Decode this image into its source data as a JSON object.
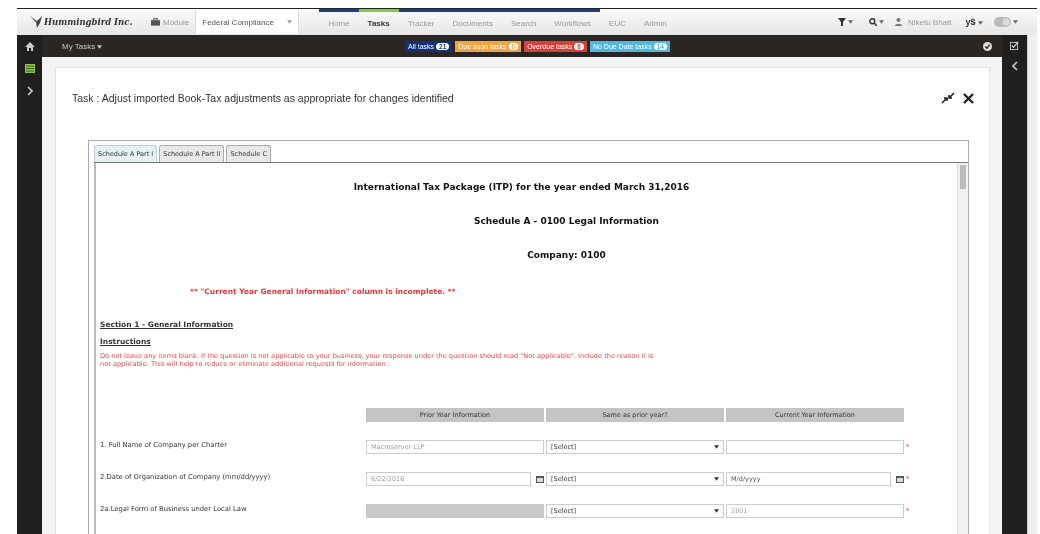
{
  "header": {
    "logo": "Hummingbird Inc.",
    "module_label": "Module",
    "module_select": "Federal Compliance",
    "nav": [
      {
        "label": "Home",
        "selected": false
      },
      {
        "label": "Tasks",
        "selected": true
      },
      {
        "label": "Tracker",
        "selected": false
      },
      {
        "label": "Documents",
        "selected": false
      },
      {
        "label": "Search",
        "selected": false
      },
      {
        "label": "Workflows",
        "selected": false
      },
      {
        "label": "EUC",
        "selected": false
      },
      {
        "label": "Admin",
        "selected": false
      }
    ],
    "user": "Niketu Bhatt",
    "currency": "y$"
  },
  "toolbar": {
    "menu": "My Tasks",
    "task_badges": [
      {
        "label": "All tasks",
        "count": "21",
        "color": "#12307a"
      },
      {
        "label": "Due soon tasks",
        "count": "0",
        "color": "#f0a540"
      },
      {
        "label": "Overdue tasks",
        "count": "6",
        "color": "#d9403a"
      },
      {
        "label": "No Due Date tasks",
        "count": "14",
        "color": "#4fb8e0"
      }
    ]
  },
  "task": {
    "title": "Task : Adjust imported Book-Tax adjustments as appropriate for changes identified",
    "tabs": [
      {
        "label": "Schedule A Part I",
        "selected": true
      },
      {
        "label": "Schedule A Part II",
        "selected": false
      },
      {
        "label": "Schedule C",
        "selected": false
      }
    ],
    "headings": [
      "International Tax Package (ITP) for the year ended March 31,2016",
      "Schedule A - 0100 Legal Information",
      "Company: 0100"
    ],
    "warning": "** \"Current Year General Information\" column is incomplete. **",
    "section_title": "Section 1 - General Information",
    "instructions_title": "Instructions",
    "instructions": "Do not leave any items blank. If the question is not applicable to your business, your response under the question should read \"Not applicable\". Include the reason it is not applicable. This will help to reduce or eliminate additional requests for information..",
    "columns": [
      "Prior Year Information",
      "Same as prior year?",
      "Current Year Information"
    ],
    "rows": [
      {
        "label": "1. Full Name of Company per Charter",
        "kind": "text",
        "prior": "Macroserver LLP",
        "same": "[Select]",
        "current": "",
        "current_placeholder": "",
        "required_mark": "*"
      },
      {
        "label": "2.Date of Organization of Company (mm/dd/yyyy)",
        "kind": "date",
        "prior": "6/22/2016",
        "same": "[Select]",
        "current": "",
        "current_placeholder": "M/d/yyyy",
        "required_mark": "*"
      },
      {
        "label": "2a.Legal Form of Business under Local Law",
        "kind": "locked",
        "prior": "",
        "same": "[Select]",
        "current": "2801",
        "current_placeholder": "",
        "required_mark": "*"
      }
    ]
  }
}
